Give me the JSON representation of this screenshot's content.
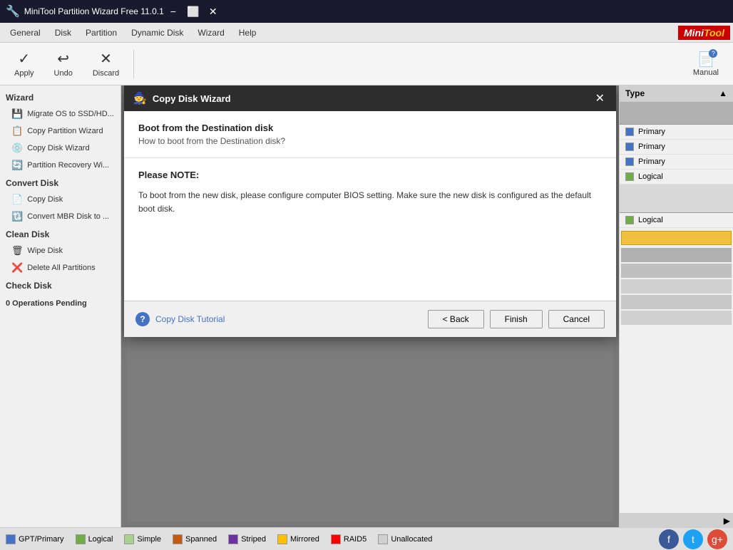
{
  "app": {
    "title": "MiniTool Partition Wizard Free 11.0.1",
    "icon": "🔧"
  },
  "window_controls": {
    "minimize": "−",
    "maximize": "⬜",
    "close": "✕"
  },
  "menubar": {
    "items": [
      "General",
      "Disk",
      "Partition",
      "Dynamic Disk",
      "Wizard",
      "Help"
    ],
    "logo_text": "MiniTool",
    "logo_highlight": "Tool"
  },
  "toolbar": {
    "apply_label": "Apply",
    "undo_label": "Undo",
    "discard_label": "Discard",
    "manual_label": "Manual"
  },
  "sidebar": {
    "wizard_section": "Wizard",
    "wizard_items": [
      {
        "label": "Migrate OS to SSD/HD...",
        "icon": "💾"
      },
      {
        "label": "Copy Partition Wizard",
        "icon": "📋"
      },
      {
        "label": "Copy Disk Wizard",
        "icon": "💿"
      },
      {
        "label": "Partition Recovery Wi...",
        "icon": "🔄"
      }
    ],
    "convert_section": "Convert Disk",
    "convert_items": [
      {
        "label": "Copy Disk",
        "icon": "📄"
      },
      {
        "label": "Convert MBR Disk to ...",
        "icon": "🔃"
      }
    ],
    "clean_section": "Clean Disk",
    "clean_items": [
      {
        "label": "Wipe Disk",
        "icon": "🗑"
      },
      {
        "label": "Delete All Partitions",
        "icon": "❌"
      }
    ],
    "check_section": "Check Disk",
    "operations_pending": "0 Operations Pending"
  },
  "right_panel": {
    "header": "Type",
    "items": [
      {
        "label": "Primary",
        "color": "primary"
      },
      {
        "label": "Primary",
        "color": "primary"
      },
      {
        "label": "Primary",
        "color": "primary"
      },
      {
        "label": "Logical",
        "color": "logical"
      },
      {
        "label": "Logical",
        "color": "logical"
      }
    ]
  },
  "modal": {
    "title": "Copy Disk Wizard",
    "close_btn": "✕",
    "header": "Boot from the Destination disk",
    "subheader": "How to boot from the Destination disk?",
    "please_note_label": "Please NOTE:",
    "note_text": "To boot from the new disk, please configure computer BIOS setting. Make sure the new disk is configured as the default boot disk.",
    "footer": {
      "help_icon": "?",
      "tutorial_link": "Copy Disk Tutorial",
      "back_btn": "< Back",
      "finish_btn": "Finish",
      "cancel_btn": "Cancel"
    }
  },
  "statusbar": {
    "legends": [
      {
        "label": "GPT/Primary",
        "class": "lg-gpt"
      },
      {
        "label": "Logical",
        "class": "lg-logical"
      },
      {
        "label": "Simple",
        "class": "lg-simple"
      },
      {
        "label": "Spanned",
        "class": "lg-spanned"
      },
      {
        "label": "Striped",
        "class": "lg-striped"
      },
      {
        "label": "Mirrored",
        "class": "lg-mirrored"
      },
      {
        "label": "RAID5",
        "class": "lg-raid5"
      },
      {
        "label": "Unallocated",
        "class": "lg-unalloc"
      }
    ],
    "social": [
      "f",
      "t",
      "g+"
    ]
  }
}
